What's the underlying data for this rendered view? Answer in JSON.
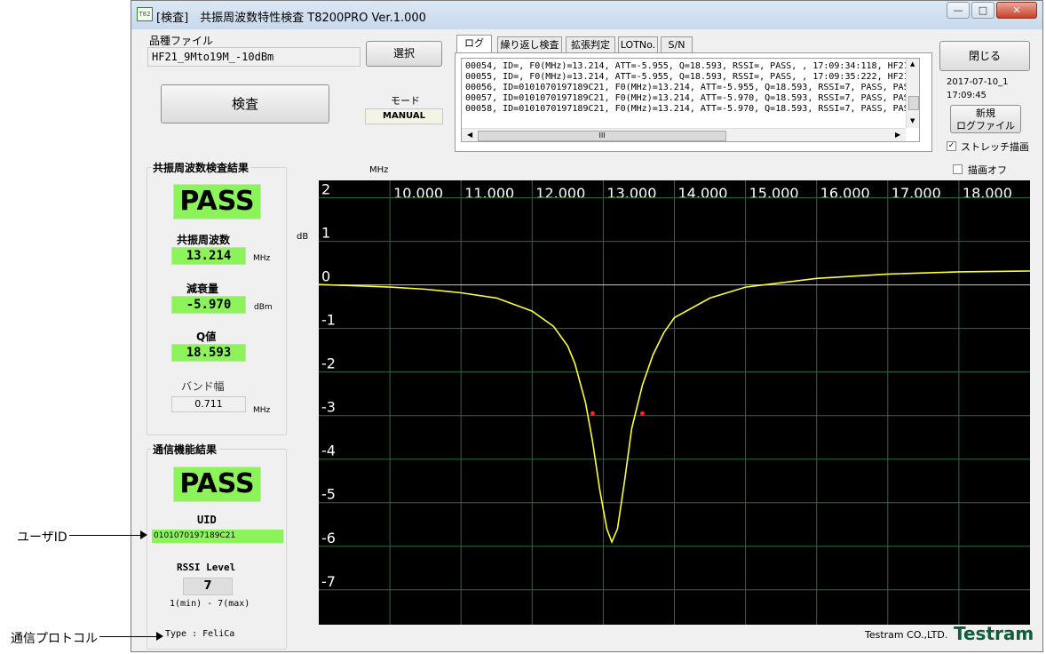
{
  "window": {
    "title": "[検査]　共振周波数特性検査 T8200PRO Ver.1.000",
    "icon_text": "T82",
    "controls": [
      "minimize-icon",
      "maximize-icon",
      "close-icon"
    ]
  },
  "file": {
    "label": "品種ファイル",
    "value": "HF21_9Mto19M_-10dBm",
    "select_button": "選択"
  },
  "inspect_button": "検査",
  "mode": {
    "label": "モード",
    "value": "MANUAL"
  },
  "tabs": [
    "ログ",
    "繰り返し検査",
    "拡張判定",
    "LOTNo.",
    "S/N"
  ],
  "log": {
    "lines": [
      "00054, ID=, F0(MHz)=13.214, ATT=-5.955, Q=18.593, RSSI=, PASS, , 17:09:34:118, HF21",
      "00055, ID=, F0(MHz)=13.214, ATT=-5.955, Q=18.593, RSSI=, PASS, , 17:09:35:222, HF21",
      "00056, ID=0101070197189C21, F0(MHz)=13.214, ATT=-5.955, Q=18.593, RSSI=7, PASS, PAS",
      "00057, ID=0101070197189C21, F0(MHz)=13.214, ATT=-5.970, Q=18.593, RSSI=7, PASS, PAS",
      "00058, ID=0101070197189C21, F0(MHz)=13.214, ATT=-5.970, Q=18.593, RSSI=7, PASS, PAS"
    ],
    "hscroll_mark": "III"
  },
  "right_panel": {
    "close_button": "閉じる",
    "date": "2017-07-10_1",
    "time": "17:09:45",
    "new_log_button_line1": "新規",
    "new_log_button_line2": "ログファイル",
    "stretch_label": "ストレッチ描画",
    "stretch_checked": true,
    "draw_off_label": "描画オフ",
    "draw_off_checked": false
  },
  "resonance": {
    "group_title": "共振周波数検査結果",
    "result": "PASS",
    "freq_label": "共振周波数",
    "freq_value": "13.214",
    "freq_unit": "MHz",
    "att_label": "減衰量",
    "att_value": "-5.970",
    "att_unit": "dBm",
    "q_label": "Q値",
    "q_value": "18.593",
    "bw_label": "バンド幅",
    "bw_value": "0.711",
    "bw_unit": "MHz"
  },
  "comm": {
    "group_title": "通信機能結果",
    "result": "PASS",
    "uid_label": "UID",
    "uid_value": "0101070197189C21",
    "rssi_label": "RSSI Level",
    "rssi_value": "7",
    "rssi_range": "1(min) - 7(max)",
    "type_text": "Type : FeliCa"
  },
  "footer": {
    "company": "Testram CO.,LTD.",
    "logo": "Testram"
  },
  "annotations": {
    "user_id": "ユーザID",
    "protocol": "通信プロトコル"
  },
  "colors": {
    "plot_bg": "#000000",
    "grid": "#2e6b3e",
    "trace": "#ffff33",
    "marker": "#ff2020",
    "pass_green": "#8df35a"
  },
  "chart_data": {
    "type": "line",
    "xlabel": "MHz",
    "ylabel": "dB",
    "x_ticks": [
      "10.000",
      "11.000",
      "12.000",
      "13.000",
      "14.000",
      "15.000",
      "16.000",
      "17.000",
      "18.000"
    ],
    "y_ticks": [
      "2",
      "1",
      "0",
      "-1",
      "-2",
      "-3",
      "-4",
      "-5",
      "-6",
      "-7"
    ],
    "xlim": [
      9.0,
      19.0
    ],
    "ylim": [
      -7.8,
      2.4
    ],
    "grid": true,
    "series": [
      {
        "x": [
          9.0,
          9.5,
          10.0,
          10.5,
          11.0,
          11.5,
          12.0,
          12.3,
          12.5,
          12.6,
          12.75,
          12.85,
          12.95,
          13.05,
          13.12,
          13.2,
          13.3,
          13.4,
          13.55,
          13.7,
          13.85,
          14.0,
          14.5,
          15.0,
          16.0,
          17.0,
          18.0,
          19.0
        ],
        "y": [
          0.01,
          -0.02,
          -0.05,
          -0.1,
          -0.18,
          -0.3,
          -0.6,
          -0.95,
          -1.4,
          -1.8,
          -2.7,
          -3.6,
          -4.7,
          -5.6,
          -5.9,
          -5.6,
          -4.5,
          -3.3,
          -2.3,
          -1.6,
          -1.1,
          -0.75,
          -0.3,
          -0.05,
          0.15,
          0.25,
          0.3,
          0.32
        ]
      }
    ],
    "markers": [
      {
        "x": 12.85,
        "y": -2.95
      },
      {
        "x": 13.55,
        "y": -2.95
      }
    ]
  }
}
